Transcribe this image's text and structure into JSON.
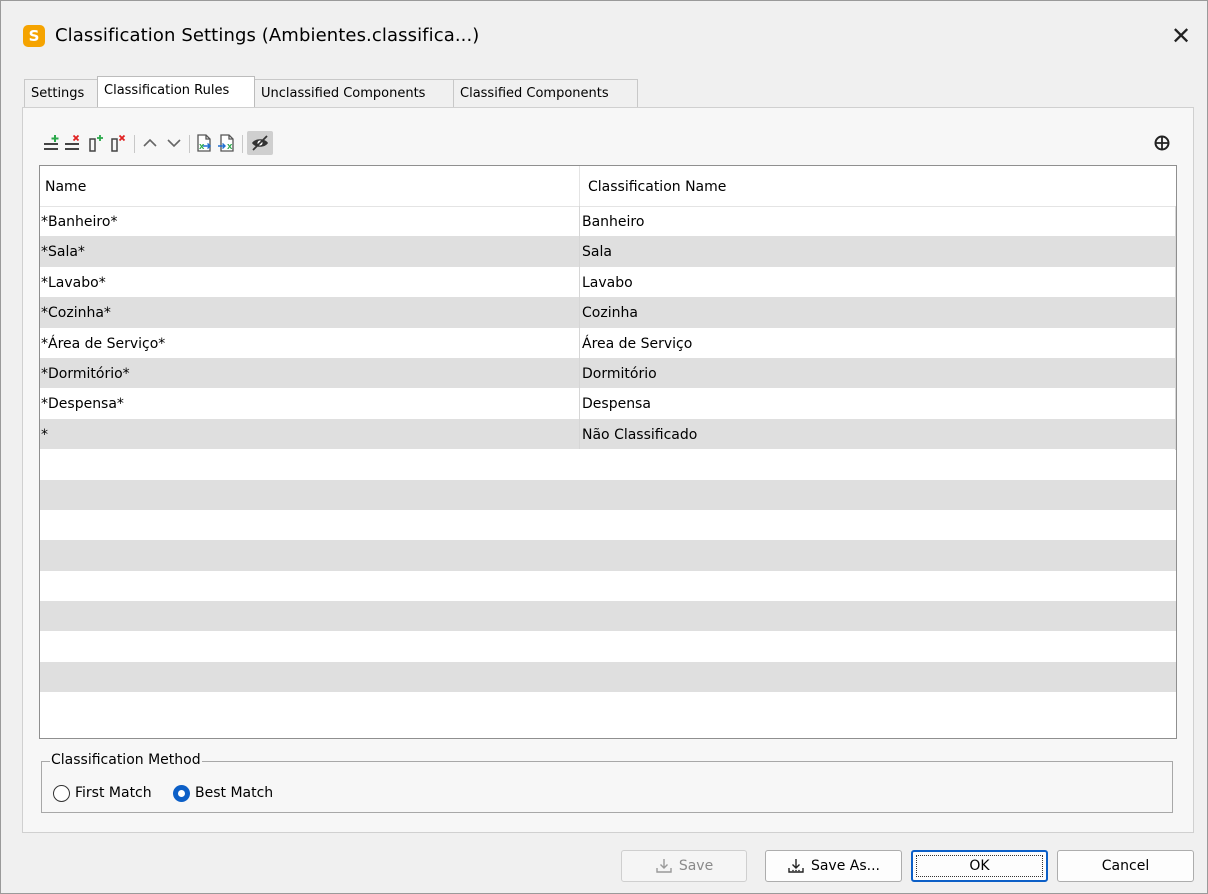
{
  "window": {
    "title": "Classification Settings (Ambientes.classifica...)",
    "app_icon_letter": "S",
    "close_glyph": "✕"
  },
  "tabs": [
    {
      "label": "Settings",
      "active": false
    },
    {
      "label": "Classification Rules",
      "active": true
    },
    {
      "label": "Unclassified Components",
      "active": false
    },
    {
      "label": "Classified Components",
      "active": false
    }
  ],
  "toolbar": {
    "icons": [
      "add-row-icon",
      "delete-row-icon",
      "add-column-icon",
      "delete-column-icon",
      "move-up-icon",
      "move-down-icon",
      "import-excel-icon",
      "export-excel-icon",
      "hide-show-toggle-icon",
      "expand-icon"
    ],
    "accent_green": "#2aa84a",
    "accent_red": "#e02020",
    "accent_blue": "#1f6fd1"
  },
  "table": {
    "columns": [
      "Name",
      "Classification Name"
    ],
    "rows": [
      [
        "*Banheiro*",
        "Banheiro"
      ],
      [
        "*Sala*",
        "Sala"
      ],
      [
        "*Lavabo*",
        "Lavabo"
      ],
      [
        "*Cozinha*",
        "Cozinha"
      ],
      [
        "*Área de Serviço*",
        "Área de Serviço"
      ],
      [
        "*Dormitório*",
        "Dormitório"
      ],
      [
        "*Despensa*",
        "Despensa"
      ],
      [
        "*",
        "Não Classificado"
      ]
    ]
  },
  "classification_method": {
    "legend": "Classification Method",
    "options": [
      {
        "label": "First Match",
        "selected": false
      },
      {
        "label": "Best Match",
        "selected": true
      }
    ]
  },
  "buttons": {
    "save": "Save",
    "save_as": "Save As...",
    "ok": "OK",
    "cancel": "Cancel"
  },
  "colors": {
    "selected_radio": "#0c5fc7",
    "alt_row": "#dfdfdf",
    "app_icon": "#f5a300"
  }
}
